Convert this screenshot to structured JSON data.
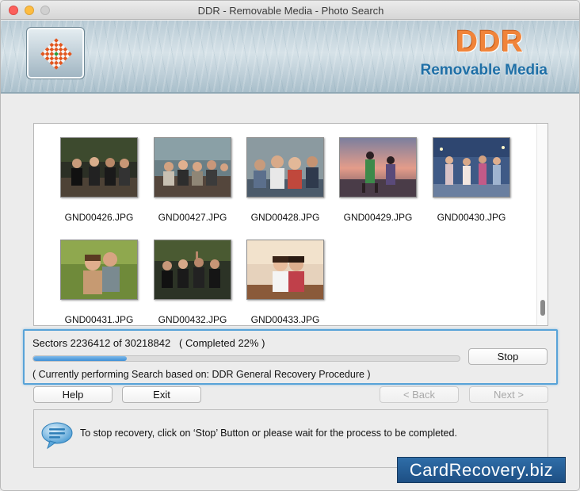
{
  "window": {
    "title": "DDR - Removable Media - Photo Search"
  },
  "banner": {
    "brand": "DDR",
    "subtitle": "Removable Media"
  },
  "photos": [
    {
      "name": "GND00426.JPG"
    },
    {
      "name": "GND00427.JPG"
    },
    {
      "name": "GND00428.JPG"
    },
    {
      "name": "GND00429.JPG"
    },
    {
      "name": "GND00430.JPG"
    },
    {
      "name": "GND00431.JPG"
    },
    {
      "name": "GND00432.JPG"
    },
    {
      "name": "GND00433.JPG"
    }
  ],
  "progress": {
    "sectors_text": "Sectors 2236412 of 30218842   ( Completed 22% )",
    "percent": 22,
    "status": "( Currently performing Search based on: DDR General Recovery Procedure )",
    "stop_label": "Stop"
  },
  "nav": {
    "help": "Help",
    "exit": "Exit",
    "back": "< Back",
    "next": "Next >"
  },
  "info": {
    "message": "To stop recovery, click on ‘Stop’ Button or please wait for the process to be completed."
  },
  "watermark": "CardRecovery.biz",
  "colors": {
    "accent": "#58a3d8",
    "brand_orange": "#f0843a",
    "brand_blue": "#1f6fa6",
    "watermark_bg": "#2f6ea8"
  }
}
